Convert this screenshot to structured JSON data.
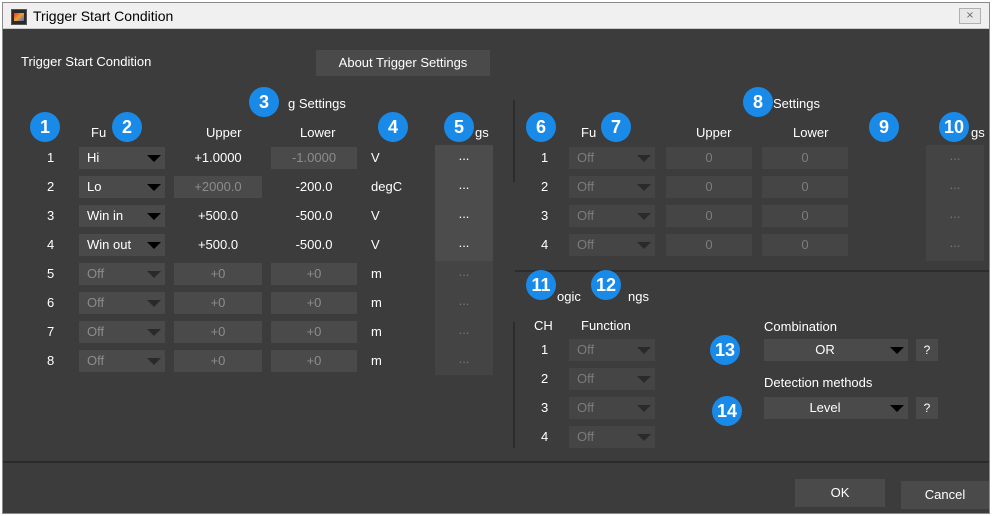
{
  "window": {
    "title": "Trigger Start Condition",
    "close_icon": "×"
  },
  "header": {
    "section_title": "Trigger Start Condition",
    "about_button": "About Trigger Settings"
  },
  "analog": {
    "section_label": "g Settings",
    "col_function": "Fu",
    "col_upper": "Upper",
    "col_lower": "Lower",
    "col_settings": "gs",
    "rows": [
      {
        "ch": "1",
        "function": "Hi",
        "upper": "+1.0000",
        "lower": "-1.0000",
        "unit": "V",
        "settings": "...",
        "enabled": true
      },
      {
        "ch": "2",
        "function": "Lo",
        "upper": "+2000.0",
        "lower": "-200.0",
        "unit": "degC",
        "settings": "...",
        "enabled": true
      },
      {
        "ch": "3",
        "function": "Win in",
        "upper": "+500.0",
        "lower": "-500.0",
        "unit": "V",
        "settings": "...",
        "enabled": true
      },
      {
        "ch": "4",
        "function": "Win out",
        "upper": "+500.0",
        "lower": "-500.0",
        "unit": "V",
        "settings": "...",
        "enabled": true
      },
      {
        "ch": "5",
        "function": "Off",
        "upper": "+0",
        "lower": "+0",
        "unit": "m",
        "settings": "...",
        "enabled": false
      },
      {
        "ch": "6",
        "function": "Off",
        "upper": "+0",
        "lower": "+0",
        "unit": "m",
        "settings": "...",
        "enabled": false
      },
      {
        "ch": "7",
        "function": "Off",
        "upper": "+0",
        "lower": "+0",
        "unit": "m",
        "settings": "...",
        "enabled": false
      },
      {
        "ch": "8",
        "function": "Off",
        "upper": "+0",
        "lower": "+0",
        "unit": "m",
        "settings": "...",
        "enabled": false
      }
    ]
  },
  "pulse": {
    "section_label": "Settings",
    "col_function": "Fu",
    "col_upper": "Upper",
    "col_lower": "Lower",
    "col_settings": "gs",
    "rows": [
      {
        "ch": "1",
        "function": "Off",
        "upper": "0",
        "lower": "0",
        "settings": "..."
      },
      {
        "ch": "2",
        "function": "Off",
        "upper": "0",
        "lower": "0",
        "settings": "..."
      },
      {
        "ch": "3",
        "function": "Off",
        "upper": "0",
        "lower": "0",
        "settings": "..."
      },
      {
        "ch": "4",
        "function": "Off",
        "upper": "0",
        "lower": "0",
        "settings": "..."
      }
    ]
  },
  "logic": {
    "section_label": "ogic",
    "section_label_end": "ngs",
    "col_ch": "CH",
    "col_function": "Function",
    "rows": [
      {
        "ch": "1",
        "function": "Off"
      },
      {
        "ch": "2",
        "function": "Off"
      },
      {
        "ch": "3",
        "function": "Off"
      },
      {
        "ch": "4",
        "function": "Off"
      }
    ]
  },
  "combination": {
    "label": "Combination",
    "value": "OR",
    "help": "?"
  },
  "detection": {
    "label": "Detection methods",
    "value": "Level",
    "help": "?"
  },
  "footer": {
    "ok": "OK",
    "cancel": "Cancel"
  },
  "badges": [
    "1",
    "2",
    "3",
    "4",
    "5",
    "6",
    "7",
    "8",
    "9",
    "10",
    "11",
    "12",
    "13",
    "14"
  ],
  "colors": {
    "background": "#3c3c3c",
    "control": "#4a4a4a",
    "badge": "#1a8ae8",
    "disabled_text": "#8c8c8c"
  }
}
